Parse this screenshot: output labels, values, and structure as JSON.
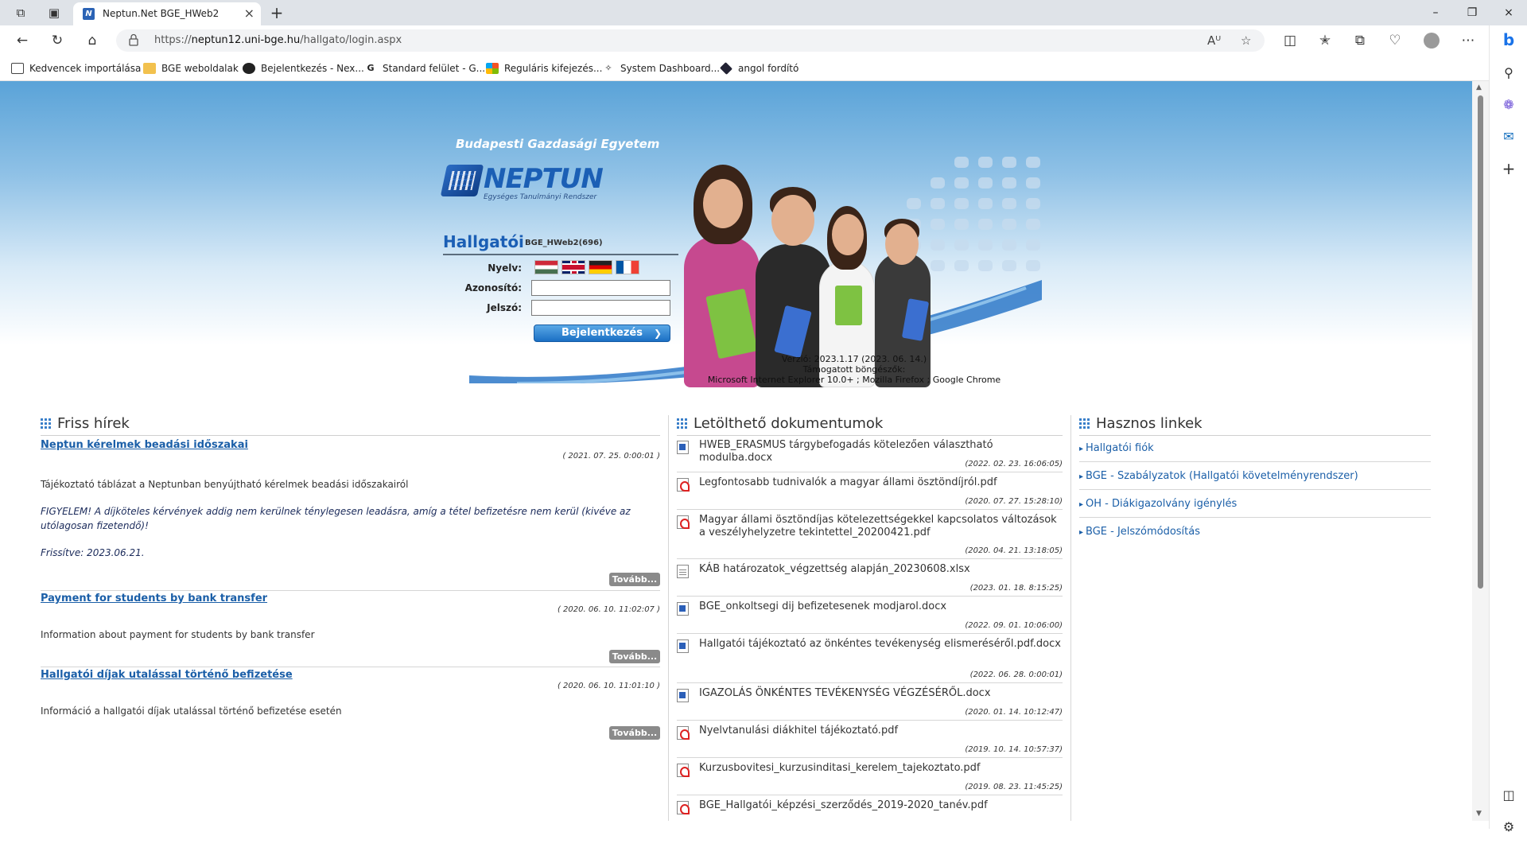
{
  "browser": {
    "tab_title": "Neptun.Net BGE_HWeb2",
    "url_prefix": "https://",
    "url_host": "neptun12.uni-bge.hu",
    "url_path": "/hallgato/login.aspx",
    "bookmarks": [
      {
        "label": "Kedvencek importálása"
      },
      {
        "label": "BGE weboldalak"
      },
      {
        "label": "Bejelentkezés - Nex..."
      },
      {
        "label": "Standard felület - G..."
      },
      {
        "label": "Reguláris kifejezés..."
      },
      {
        "label": "System Dashboard..."
      },
      {
        "label": "angol fordító"
      }
    ]
  },
  "banner": {
    "university": "Budapesti Gazdasági Egyetem",
    "logo_word": "NEPTUN",
    "logo_sub": "Egységes Tanulmányi Rendszer",
    "role": "Hallgatói",
    "server": "BGE_HWeb2(696)",
    "language_label": "Nyelv:",
    "username_label": "Azonosító:",
    "password_label": "Jelszó:",
    "username_value": "",
    "password_value": "",
    "login_button": "Bejelentkezés",
    "version": "Verzió: 2023.1.17 (2023. 06. 14.)",
    "supported_label": "Támogatott böngészők:",
    "supported_browsers": "Microsoft Internet Explorer 10.0+ ; Mozilla Firefox ; Google Chrome"
  },
  "news": {
    "title": "Friss hírek",
    "more_label": "Tovább...",
    "items": [
      {
        "title": "Neptun kérelmek beadási időszakai",
        "date": "( 2021. 07. 25. 0:00:01 )",
        "p1": "Tájékoztató táblázat a Neptunban benyújtható kérelmek beadási időszakairól",
        "p2": " FIGYELEM! A díjköteles kérvények addig nem kerülnek ténylegesen leadásra, amíg a tétel befizetésre nem kerül (kivéve az",
        "p3": "utólagosan fizetendő)!",
        "p4": "Frissítve: 2023.06.21."
      },
      {
        "title": "Payment for students by bank transfer",
        "date": "( 2020. 06. 10. 11:02:07 )",
        "p1": "Information about payment for students by bank transfer"
      },
      {
        "title": "Hallgatói díjak utalással történő befizetése",
        "date": "( 2020. 06. 10. 11:01:10 )",
        "p1": "Információ a hallgatói díjak utalással történő befizetése esetén"
      }
    ]
  },
  "docs": {
    "title": "Letölthető dokumentumok",
    "items": [
      {
        "name": "HWEB_ERASMUS tárgybefogadás kötelezően választható modulba.docx",
        "date": "(2022. 02. 23. 16:06:05)",
        "type": "docx"
      },
      {
        "name": "Legfontosabb tudnivalók a magyar állami ösztöndíjról.pdf",
        "date": "(2020. 07. 27. 15:28:10)",
        "type": "pdf"
      },
      {
        "name": "Magyar állami ösztöndíjas kötelezettségekkel kapcsolatos változások a veszélyhelyzetre tekintettel_20200421.pdf",
        "date": "(2020. 04. 21. 13:18:05)",
        "type": "pdf"
      },
      {
        "name": "KÁB határozatok_végzettség alapján_20230608.xlsx",
        "date": "(2023. 01. 18. 8:15:25)",
        "type": "xlsx"
      },
      {
        "name": "BGE_onkoltsegi dij befizetesenek modjarol.docx",
        "date": "(2022. 09. 01. 10:06:00)",
        "type": "docx"
      },
      {
        "name": "Hallgatói tájékoztató az önkéntes tevékenység elismeréséről.pdf.docx",
        "date": "(2022. 06. 28. 0:00:01)",
        "type": "docx"
      },
      {
        "name": "IGAZOLÁS ÖNKÉNTES TEVÉKENYSÉG VÉGZÉSÉRŐL.docx",
        "date": "(2020. 01. 14. 10:12:47)",
        "type": "docx"
      },
      {
        "name": "Nyelvtanulási diákhitel tájékoztató.pdf",
        "date": "(2019. 10. 14. 10:57:37)",
        "type": "pdf"
      },
      {
        "name": "Kurzusbovitesi_kurzusinditasi_kerelem_tajekoztato.pdf",
        "date": "(2019. 08. 23. 11:45:25)",
        "type": "pdf"
      },
      {
        "name": "BGE_Hallgatói_képzési_szerződés_2019-2020_tanév.pdf",
        "date": "",
        "type": "pdf"
      }
    ]
  },
  "links": {
    "title": "Hasznos linkek",
    "items": [
      {
        "label": "Hallgatói fiók"
      },
      {
        "label": "BGE - Szabályzatok (Hallgatói követelményrendszer)"
      },
      {
        "label": "OH - Diákigazolvány igénylés"
      },
      {
        "label": "BGE - Jelszómódosítás"
      }
    ]
  },
  "colors": {
    "link": "#1b5fa8",
    "brand": "#1b5fb5",
    "button": "#1a6fc4"
  }
}
